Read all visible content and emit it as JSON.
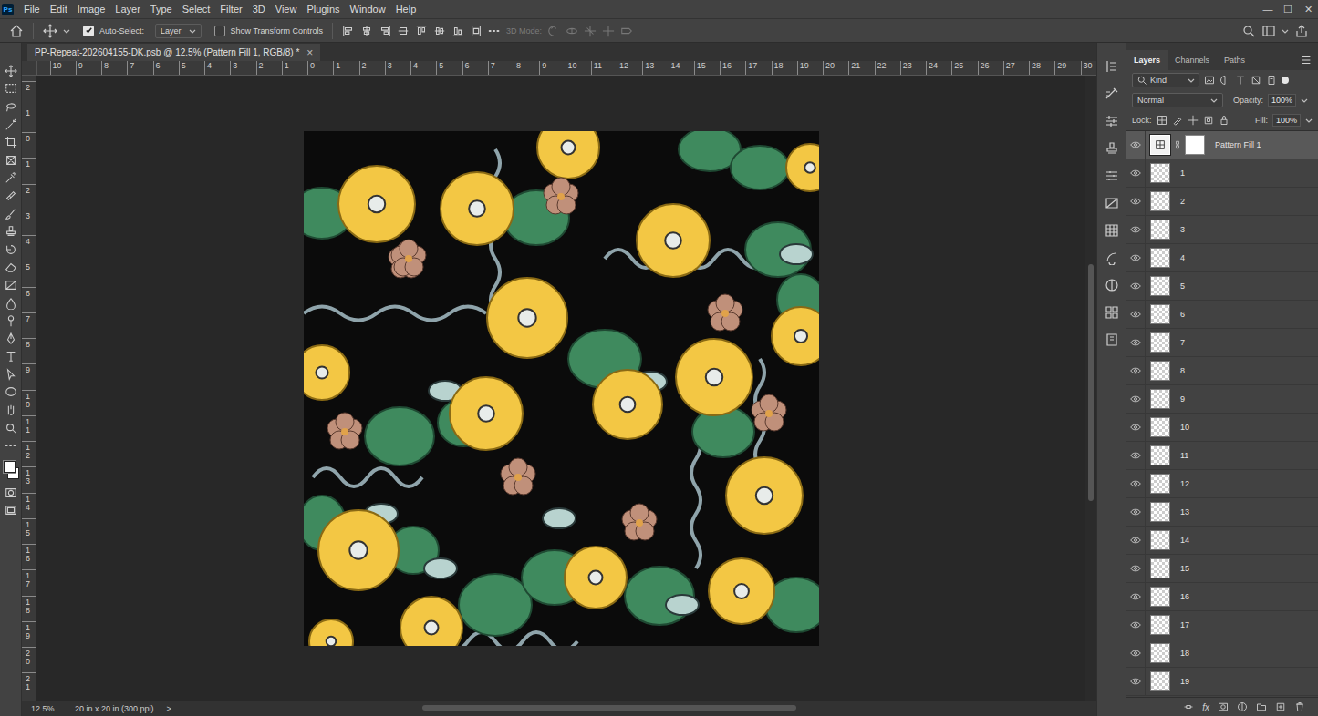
{
  "app": {
    "logo": "Ps"
  },
  "menu": [
    "File",
    "Edit",
    "Image",
    "Layer",
    "Type",
    "Select",
    "Filter",
    "3D",
    "View",
    "Plugins",
    "Window",
    "Help"
  ],
  "window_controls": [
    "—",
    "☐",
    "✕"
  ],
  "options_bar": {
    "auto_select": {
      "label": "Auto-Select:",
      "checked": true
    },
    "target": "Layer",
    "show_transform": {
      "label": "Show Transform Controls",
      "checked": false
    },
    "mode_3d": {
      "label": "3D Mode:",
      "disabled": true
    }
  },
  "document_tab": {
    "title": "PP-Repeat-202604155-DK.psb @ 12.5% (Pattern Fill 1, RGB/8) *",
    "close": "×"
  },
  "ruler": {
    "h_labels": [
      "10",
      "9",
      "8",
      "7",
      "6",
      "5",
      "4",
      "3",
      "2",
      "1",
      "0",
      "1",
      "2",
      "3",
      "4",
      "5",
      "6",
      "7",
      "8",
      "9",
      "10",
      "11",
      "12",
      "13",
      "14",
      "15",
      "16",
      "17",
      "18",
      "19",
      "20",
      "21",
      "22",
      "23",
      "24",
      "25",
      "26",
      "27",
      "28",
      "29",
      "30"
    ],
    "v_labels": [
      "2",
      "1",
      "0",
      "1",
      "2",
      "3",
      "4",
      "5",
      "6",
      "7",
      "8",
      "9",
      "10",
      "11",
      "12",
      "13",
      "14",
      "15",
      "16",
      "17",
      "18",
      "19",
      "20",
      "21"
    ]
  },
  "status_bar": {
    "zoom": "12.5%",
    "doc_size": "20 in x 20 in (300 ppi)",
    "arrow": ">"
  },
  "layers_panel": {
    "tabs": [
      {
        "label": "Layers",
        "selected": true
      },
      {
        "label": "Channels",
        "selected": false
      },
      {
        "label": "Paths",
        "selected": false
      }
    ],
    "filter": "Kind",
    "blend_mode": "Normal",
    "opacity_label": "Opacity:",
    "opacity": "100%",
    "lock_label": "Lock:",
    "fill_label": "Fill:",
    "fill": "100%",
    "fx_label": "fx",
    "layers": [
      {
        "name": "Pattern Fill 1",
        "kind": "fill",
        "selected": true,
        "visible": true
      },
      {
        "name": "1",
        "kind": "pixel",
        "selected": false,
        "visible": true
      },
      {
        "name": "2",
        "kind": "pixel",
        "selected": false,
        "visible": true
      },
      {
        "name": "3",
        "kind": "pixel",
        "selected": false,
        "visible": true
      },
      {
        "name": "4",
        "kind": "pixel",
        "selected": false,
        "visible": true
      },
      {
        "name": "5",
        "kind": "pixel",
        "selected": false,
        "visible": true
      },
      {
        "name": "6",
        "kind": "pixel",
        "selected": false,
        "visible": true
      },
      {
        "name": "7",
        "kind": "pixel",
        "selected": false,
        "visible": true
      },
      {
        "name": "8",
        "kind": "pixel",
        "selected": false,
        "visible": true
      },
      {
        "name": "9",
        "kind": "pixel",
        "selected": false,
        "visible": true
      },
      {
        "name": "10",
        "kind": "pixel",
        "selected": false,
        "visible": true
      },
      {
        "name": "11",
        "kind": "pixel",
        "selected": false,
        "visible": true
      },
      {
        "name": "12",
        "kind": "pixel",
        "selected": false,
        "visible": true
      },
      {
        "name": "13",
        "kind": "pixel",
        "selected": false,
        "visible": true
      },
      {
        "name": "14",
        "kind": "pixel",
        "selected": false,
        "visible": true
      },
      {
        "name": "15",
        "kind": "pixel",
        "selected": false,
        "visible": true
      },
      {
        "name": "16",
        "kind": "pixel",
        "selected": false,
        "visible": true
      },
      {
        "name": "17",
        "kind": "pixel",
        "selected": false,
        "visible": true
      },
      {
        "name": "18",
        "kind": "pixel",
        "selected": false,
        "visible": true
      },
      {
        "name": "19",
        "kind": "pixel",
        "selected": false,
        "visible": true
      }
    ]
  }
}
